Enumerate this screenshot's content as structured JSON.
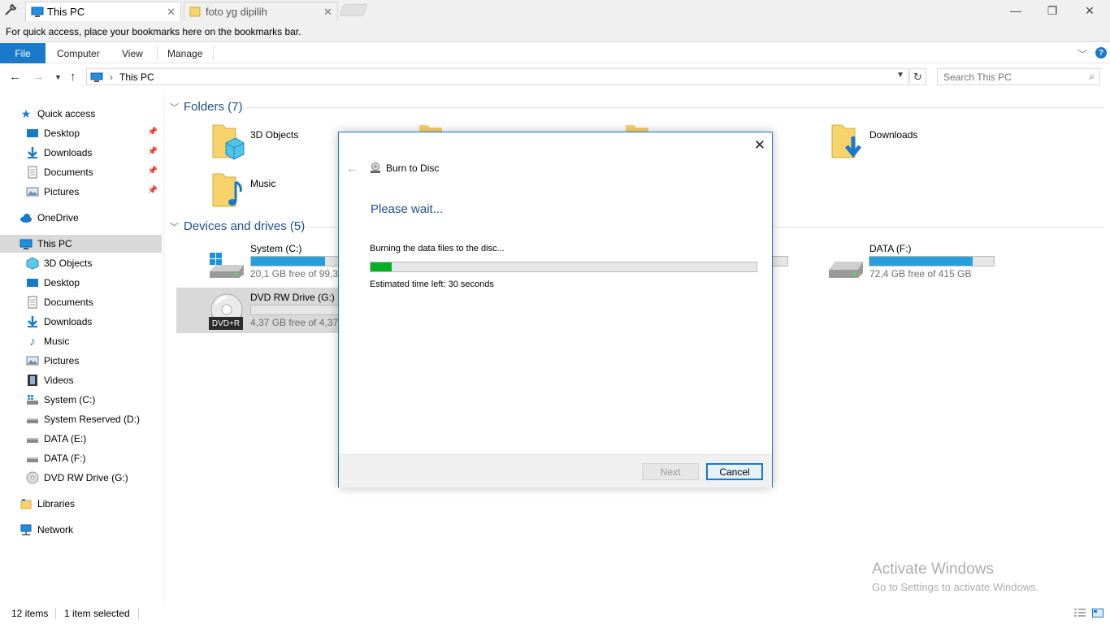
{
  "tabs": [
    {
      "label": "This PC",
      "active": true,
      "icon": "pc-icon"
    },
    {
      "label": "foto yg dipilih",
      "active": false,
      "icon": "folder-icon"
    }
  ],
  "window_controls": {
    "minimize": "—",
    "restore": "❐",
    "close": "✕"
  },
  "bookmarks_bar": "For quick access, place your bookmarks here on the bookmarks bar.",
  "ribbon": {
    "file": "File",
    "tabs": [
      "Computer",
      "View",
      "Manage"
    ],
    "help": "?"
  },
  "address": {
    "path": "This PC",
    "search_placeholder": "Search This PC"
  },
  "sidebar": {
    "quick_access": "Quick access",
    "quick_items": [
      {
        "label": "Desktop",
        "icon": "desktop-icon"
      },
      {
        "label": "Downloads",
        "icon": "downloads-icon"
      },
      {
        "label": "Documents",
        "icon": "documents-icon"
      },
      {
        "label": "Pictures",
        "icon": "pictures-icon"
      }
    ],
    "onedrive": "OneDrive",
    "this_pc": "This PC",
    "pc_items": [
      {
        "label": "3D Objects",
        "icon": "3d-objects-icon"
      },
      {
        "label": "Desktop",
        "icon": "desktop-icon"
      },
      {
        "label": "Documents",
        "icon": "documents-icon"
      },
      {
        "label": "Downloads",
        "icon": "downloads-icon"
      },
      {
        "label": "Music",
        "icon": "music-icon"
      },
      {
        "label": "Pictures",
        "icon": "pictures-icon"
      },
      {
        "label": "Videos",
        "icon": "videos-icon"
      },
      {
        "label": "System (C:)",
        "icon": "system-drive-icon"
      },
      {
        "label": "System Reserved (D:)",
        "icon": "drive-icon"
      },
      {
        "label": "DATA (E:)",
        "icon": "drive-icon"
      },
      {
        "label": "DATA (F:)",
        "icon": "drive-icon"
      },
      {
        "label": "DVD RW Drive (G:)",
        "icon": "dvd-icon"
      }
    ],
    "libraries": "Libraries",
    "network": "Network"
  },
  "content": {
    "folders_heading": "Folders (7)",
    "folders": {
      "objects3d": "3D Objects",
      "downloads": "Downloads",
      "music": "Music"
    },
    "devices_heading": "Devices and drives (5)",
    "drives": {
      "system_c": {
        "name": "System (C:)",
        "free": "20,1 GB free of 99,3 GB",
        "used_fraction": 0.8
      },
      "data_f": {
        "name": "DATA (F:)",
        "free": "72,4 GB free of 415 GB",
        "used_fraction": 0.83
      },
      "dvd_g": {
        "name": "DVD RW Drive (G:)",
        "free": "4,37 GB free of 4,37 GB",
        "used_fraction": 0.0,
        "badge": "DVD+R"
      }
    }
  },
  "dialog": {
    "title": "Burn to Disc",
    "heading": "Please wait...",
    "status": "Burning the data files to the disc...",
    "progress_fraction": 0.055,
    "time_left": "Estimated time left: 30 seconds",
    "next": "Next",
    "cancel": "Cancel"
  },
  "watermark": {
    "line1": "Activate Windows",
    "line2": "Go to Settings to activate Windows."
  },
  "statusbar": {
    "items": "12 items",
    "selected": "1 item selected"
  },
  "colors": {
    "accent": "#1979ca",
    "drive_bar": "#26a0da",
    "burn_progress": "#06b025",
    "heading": "#1e4e8c"
  }
}
